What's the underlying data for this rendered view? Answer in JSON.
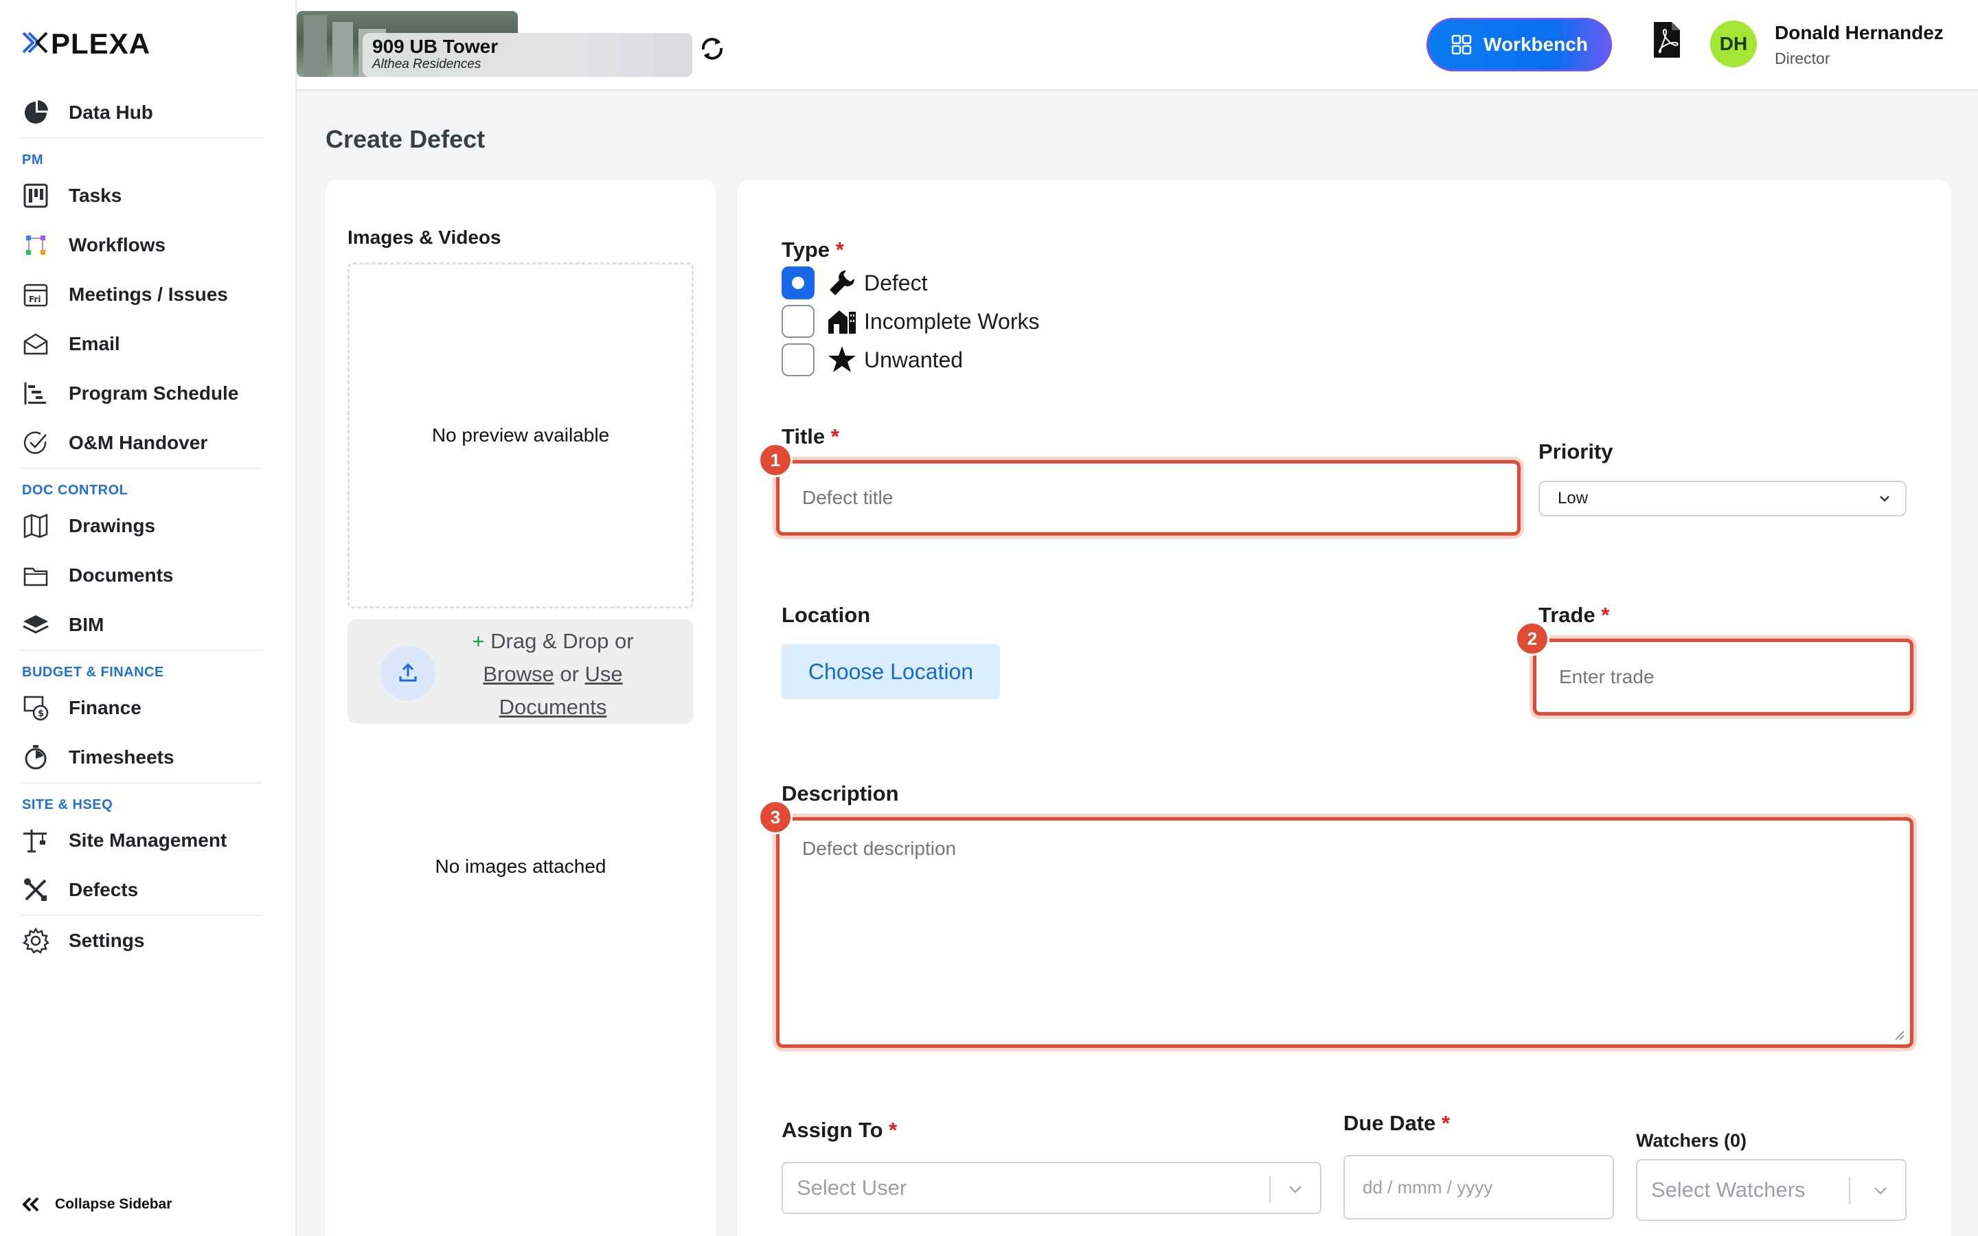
{
  "sidebar": {
    "logo": "PLEXA",
    "items": [
      {
        "label": "Data Hub",
        "icon": "pie-chart-icon"
      },
      {
        "label": "Tasks",
        "icon": "kanban-icon"
      },
      {
        "label": "Workflows",
        "icon": "workflow-icon"
      },
      {
        "label": "Meetings / Issues",
        "icon": "calendar-icon"
      },
      {
        "label": "Email",
        "icon": "email-icon"
      },
      {
        "label": "Program Schedule",
        "icon": "gantt-icon"
      },
      {
        "label": "O&M Handover",
        "icon": "check-circle-icon"
      },
      {
        "label": "Drawings",
        "icon": "map-icon"
      },
      {
        "label": "Documents",
        "icon": "folder-icon"
      },
      {
        "label": "BIM",
        "icon": "layers-icon"
      },
      {
        "label": "Finance",
        "icon": "finance-icon"
      },
      {
        "label": "Timesheets",
        "icon": "stopwatch-icon"
      },
      {
        "label": "Site Management",
        "icon": "crane-icon"
      },
      {
        "label": "Defects",
        "icon": "tools-icon"
      },
      {
        "label": "Settings",
        "icon": "gear-icon"
      }
    ],
    "sections": {
      "pm": "PM",
      "doc": "DOC CONTROL",
      "budget": "BUDGET & FINANCE",
      "site": "SITE & HSEQ"
    },
    "collapse_label": "Collapse Sidebar"
  },
  "header": {
    "project_name": "909 UB Tower",
    "project_sub": "Althea Residences",
    "workbench_label": "Workbench",
    "user_initials": "DH",
    "user_name": "Donald Hernandez",
    "user_role": "Director",
    "colors": {
      "accent": "#0a7bf0",
      "avatar": "#a3e635"
    }
  },
  "page": {
    "title": "Create Defect"
  },
  "media": {
    "label": "Images & Videos",
    "no_preview": "No preview available",
    "upload_plus": "+",
    "upload_drag": "Drag & Drop or",
    "upload_browse": "Browse",
    "upload_or": "or",
    "upload_use_docs": "Use Documents",
    "no_images": "No images attached"
  },
  "form": {
    "type_label": "Type",
    "types": [
      {
        "label": "Defect",
        "checked": true,
        "icon": "wrench-icon"
      },
      {
        "label": "Incomplete Works",
        "checked": false,
        "icon": "house-icon"
      },
      {
        "label": "Unwanted",
        "checked": false,
        "icon": "star-icon"
      }
    ],
    "title_label": "Title",
    "title_placeholder": "Defect title",
    "priority_label": "Priority",
    "priority_value": "Low",
    "location_label": "Location",
    "choose_location": "Choose Location",
    "trade_label": "Trade",
    "trade_placeholder": "Enter trade",
    "description_label": "Description",
    "description_placeholder": "Defect description",
    "assign_label": "Assign To",
    "assign_placeholder": "Select User",
    "due_label": "Due Date",
    "due_placeholder": "dd / mmm / yyyy",
    "watchers_label": "Watchers (0)",
    "watchers_placeholder": "Select Watchers",
    "required_mark": "*",
    "badges": [
      "1",
      "2",
      "3"
    ]
  }
}
